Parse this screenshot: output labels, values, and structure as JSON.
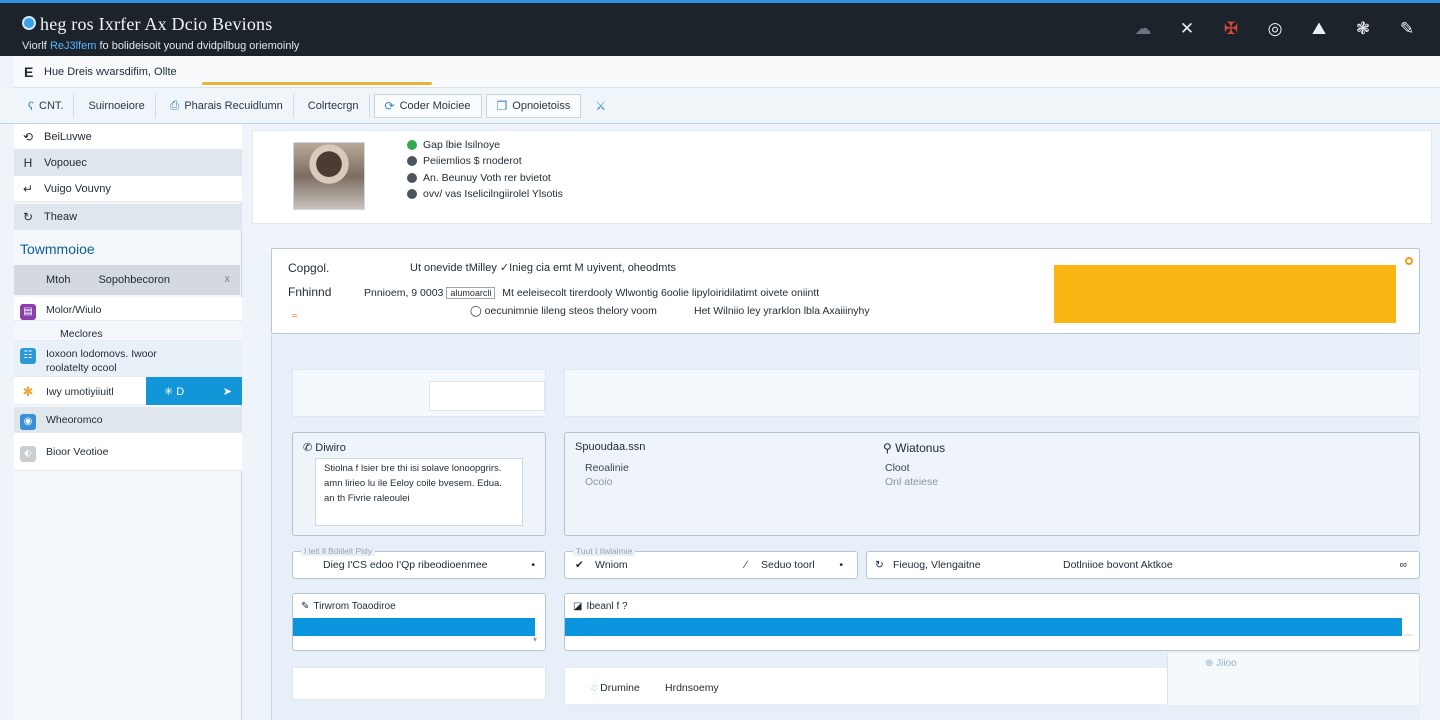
{
  "window": {
    "title": "heg ros Ixrfer Ax Dcio Bevions",
    "subtitle_prefix": "Viorlf",
    "subtitle_highlight": "ReJ3lfem",
    "subtitle_rest": "fo bolideisoit yound dvidpilbug oriemoinly",
    "title_icons": [
      "cloud-icon",
      "chart-icon",
      "flag-icon",
      "globe-icon",
      "mountain-icon",
      "spider-icon",
      "feather-icon"
    ]
  },
  "address": {
    "icon": "E",
    "text": "Hue Dreis wvarsdifim,  Ollte"
  },
  "toolbar": {
    "items": [
      {
        "icon": "ʕ",
        "label": "CNT."
      },
      {
        "icon": "",
        "label": "Suirnoeiore"
      },
      {
        "icon": "⎙",
        "label": "Pharais Recuidlumn"
      },
      {
        "icon": "",
        "label": "Colrtecrgn"
      },
      {
        "icon": "⟳",
        "label": "Coder Moiciee"
      },
      {
        "icon": "❐",
        "label": "Opnoietoiss"
      }
    ],
    "trailing": "⚔"
  },
  "sidebar": {
    "rows": [
      {
        "icon": "⟲",
        "label": "BeiLuvwe"
      },
      {
        "icon": "H",
        "label": "Vopouec"
      },
      {
        "icon": "↵",
        "label": "Vuigo  Vouvny"
      },
      {
        "icon": "↻",
        "label": "Theaw"
      }
    ],
    "heading": "Towmmoioe",
    "filter": {
      "a": "Mtoh",
      "b": "Sopohbecoron",
      "close": "x"
    },
    "apps": [
      {
        "label": "Molor/Wiulo",
        "color": "#8b3fae",
        "glyph": "▤"
      },
      {
        "label": "Meclores",
        "color": "",
        "glyph": ""
      },
      {
        "label": "Ioxoon lodomovs.  Iwoor\nroolatelty ocool",
        "color": "#2a9ad6",
        "glyph": "☷"
      },
      {
        "label": "Iwy umotiyiiuitl",
        "color": "#f0a63a",
        "glyph": "✱"
      },
      {
        "label": "Wheoromco",
        "color": "#3a8fd6",
        "glyph": "◉"
      },
      {
        "label": "Bioor Veotioe",
        "color": "#c9ced3",
        "glyph": "⬖"
      }
    ],
    "active": {
      "label": "✳ D",
      "arrow": "➤"
    }
  },
  "profile": {
    "lines": [
      "Gap lbie lsilnoye",
      "Peiiemlios $ rnoderot",
      "An. Beunuy Voth rer bvietot",
      "ovv/ vas  Iselicilngiirolel Ylsotis"
    ]
  },
  "contact": {
    "label1": "Copgol.",
    "label2": "Fnhinnd",
    "line1": "Ut onevide  tMilley  ✓Inieg cia emt   M  uyivent, oheodmts",
    "line2_prefix": "Pnnioem, 9 0003",
    "line2_tag": "alumoarcli",
    "line2_rest": "Mt  eeleisecolt tirerdooly  Wlwontig  6oolie lipyloiridilatimt oivete oniintt",
    "line3a": "oecunimnie lileng steos thelory voom",
    "line3b": "Het Wilniio ley yrarklon  lbla Axaiiinyhy",
    "squiggle": "≈"
  },
  "panels": {
    "phone": {
      "title": "Diwiro",
      "note": "Stiolna f lsier bre thi isi solave lonoopgrirs. amn lirieo lu ile Eeloy coile bvesem. Edua. an th Fivrie raleoulei"
    },
    "summary": {
      "title": "Spuoudaa.ssn",
      "k1": "Reoalinie",
      "v1": "Ocoio",
      "w_title": "Wiatonus",
      "k2": "Cloot",
      "v2": "Onl ateiese"
    }
  },
  "strips": {
    "left": {
      "cap": "I lelt ll Bdiilelt Pldy",
      "text": "Dieg I'CS edoo I'Qp ribeodioenmee",
      "end": "•"
    },
    "mid": {
      "cap": "Tuut I tlwlalmie",
      "icon": "✔",
      "a": "Wniom",
      "b_icon": "∕",
      "b": "Seduo toorl",
      "end": "•"
    },
    "right": {
      "icon": "↻",
      "a": "Fieuog, Vlengaitne",
      "b": "Dotlniioe bovont  Aktkoe",
      "end": "∞"
    }
  },
  "progress": {
    "left": {
      "title": "Tirwrom Toaodiroe",
      "fraction": 1.0,
      "tail": "▾"
    },
    "right": {
      "title": "Ibeanl f ?",
      "fraction": 0.98,
      "tail": "⁀"
    },
    "accent": "#0b95de"
  },
  "bottom": {
    "a": "Drumine",
    "b": "Hrdnsoemy",
    "corner_label": "Jiioo"
  },
  "colors": {
    "brand": "#2f8fe0",
    "titlebar": "#1d232b",
    "orange": "#fbb614",
    "progress": "#0b95de"
  }
}
